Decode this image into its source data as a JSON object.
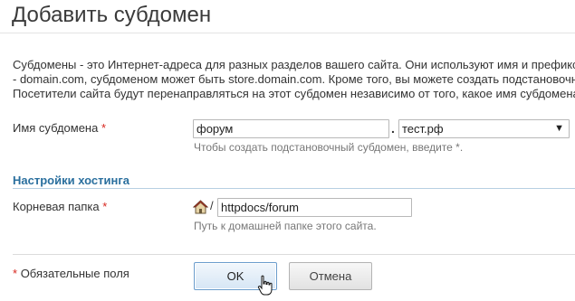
{
  "page": {
    "title": "Добавить субдомен",
    "description": [
      "Субдомены - это Интернет-адреса для разных разделов вашего сайта. Они используют имя и префикс",
      "- domain.com, субдоменом может быть store.domain.com. Кроме того, вы можете создать подстановочн",
      "Посетители сайта будут перенаправляться на этот субдомен независимо от того, какое имя субдомена"
    ]
  },
  "subdomain": {
    "label": "Имя субдомена",
    "required_mark": "*",
    "value": "форум",
    "separator": ".",
    "domain_selected": "тест.рф",
    "dropdown_arrow": "▼",
    "hint": "Чтобы создать подстановочный субдомен, введите *."
  },
  "hosting": {
    "section_title": "Настройки хостинга",
    "root_label": "Корневая папка",
    "required_mark": "*",
    "home_icon": "home-icon",
    "path_separator": "/",
    "path_value": "httpdocs/forum",
    "hint": "Путь к домашней папке этого сайта."
  },
  "footer": {
    "required_mark": "*",
    "required_note": "Обязательные поля",
    "ok_label": "OK",
    "cancel_label": "Отмена"
  },
  "colors": {
    "section_title": "#2a6f9e",
    "required": "#d7261e",
    "ok_border": "#6a9ccc"
  }
}
